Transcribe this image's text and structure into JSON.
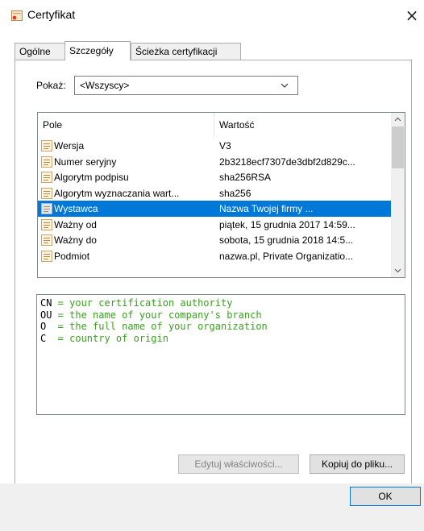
{
  "window": {
    "title": "Certyfikat",
    "close_glyph": "×"
  },
  "tabs": [
    {
      "label": "Ogólne",
      "active": false
    },
    {
      "label": "Szczegóły",
      "active": true
    },
    {
      "label": "Ścieżka certyfikacji",
      "active": false
    }
  ],
  "filter": {
    "label": "Pokaż:",
    "value": "<Wszyscy>"
  },
  "list": {
    "columns": [
      "Pole",
      "Wartość"
    ],
    "rows": [
      {
        "field": "Wersja",
        "value": "V3",
        "selected": false
      },
      {
        "field": "Numer seryjny",
        "value": "2b3218ecf7307de3dbf2d829c...",
        "selected": false
      },
      {
        "field": "Algorytm podpisu",
        "value": "sha256RSA",
        "selected": false
      },
      {
        "field": "Algorytm wyznaczania wart...",
        "value": "sha256",
        "selected": false
      },
      {
        "field": "Wystawca",
        "value": "Nazwa Twojej firmy ...",
        "selected": true
      },
      {
        "field": "Ważny od",
        "value": "piątek, 15 grudnia 2017 14:59...",
        "selected": false
      },
      {
        "field": "Ważny do",
        "value": "sobota, 15 grudnia 2018 14:5...",
        "selected": false
      },
      {
        "field": "Podmiot",
        "value": "nazwa.pl, Private Organizatio...",
        "selected": false
      }
    ]
  },
  "detail": {
    "lines": [
      {
        "key": "CN",
        "text": " = your certification authority"
      },
      {
        "key": "OU",
        "text": " = the name of your company's branch"
      },
      {
        "key": "O",
        "text": "  = the full name of your organization"
      },
      {
        "key": "C",
        "text": "  = country of origin"
      }
    ]
  },
  "buttons": {
    "edit": "Edytuj właściwości...",
    "copy": "Kopiuj do pliku...",
    "ok": "OK"
  },
  "colors": {
    "selection": "#0078d7",
    "detail_text": "#3aa01f",
    "accent": "#0078d7"
  },
  "icons": {
    "title": "certificate-icon",
    "row": "certificate-field-icon",
    "combo": "chevron-down-icon"
  }
}
